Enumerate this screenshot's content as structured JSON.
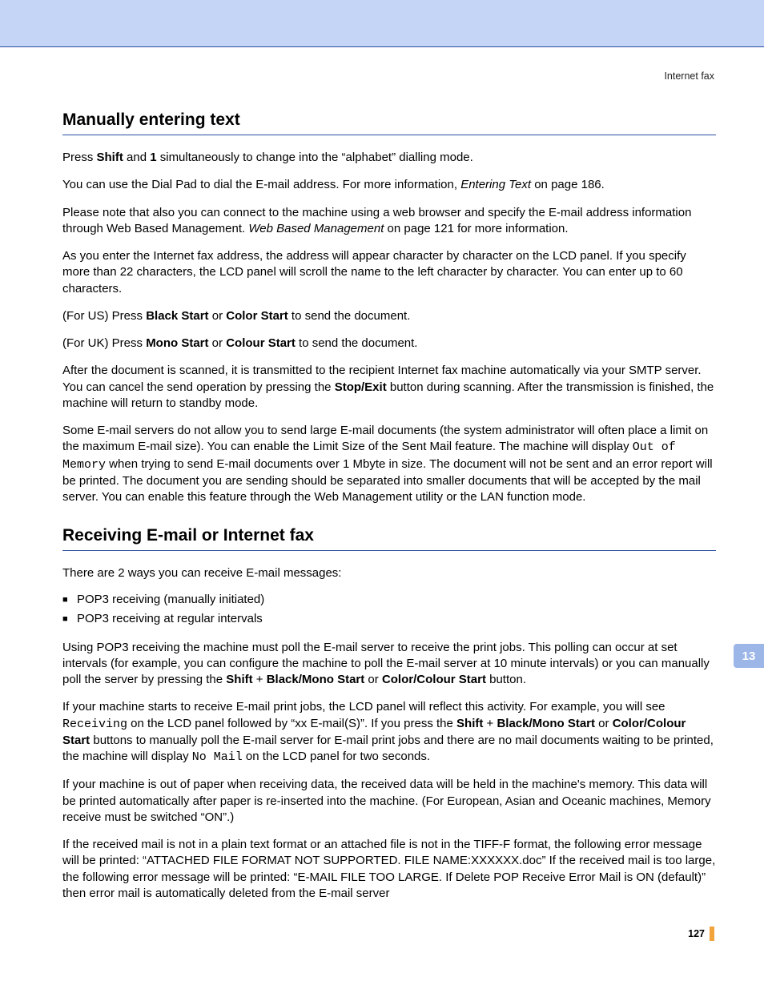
{
  "header": {
    "right": "Internet fax"
  },
  "section1": {
    "title": "Manually entering text",
    "p1_a": "Press ",
    "p1_b": "Shift",
    "p1_c": " and ",
    "p1_d": "1",
    "p1_e": " simultaneously to change into the “alphabet” dialling mode.",
    "p2_a": "You can use the Dial Pad to dial the E-mail address. For more information, ",
    "p2_b": "Entering Text",
    "p2_c": " on page 186.",
    "p3_a": "Please note that also you can connect to the machine using a web browser and specify the E-mail address information through Web Based Management. ",
    "p3_b": "Web Based Management",
    "p3_c": " on page 121 for more information.",
    "p4": "As you enter the Internet fax address, the address will appear character by character on the LCD panel. If you specify more than 22 characters, the LCD panel will scroll the name to the left character by character. You can enter up to 60 characters.",
    "p5_a": "(For US) Press ",
    "p5_b": "Black Start",
    "p5_c": " or ",
    "p5_d": "Color Start",
    "p5_e": " to send the document.",
    "p6_a": "(For UK) Press ",
    "p6_b": "Mono Start",
    "p6_c": " or ",
    "p6_d": "Colour Start",
    "p6_e": " to send the document.",
    "p7_a": "After the document is scanned, it is transmitted to the recipient Internet fax machine automatically via your SMTP server. You can cancel the send operation by pressing the ",
    "p7_b": "Stop/Exit",
    "p7_c": " button during scanning. After the transmission is finished, the machine will return to standby mode.",
    "p8_a": "Some E-mail servers do not allow you to send large E-mail documents (the system administrator will often place a limit on the maximum E-mail size). You can enable the Limit Size of the Sent Mail feature. The machine will display ",
    "p8_b": "Out of Memory",
    "p8_c": " when trying to send E-mail documents over 1 Mbyte in size. The document will not be sent and an error report will be printed. The document you are sending should be separated into smaller documents that will be accepted by the mail server. You can enable this feature through the Web Management utility or the LAN function mode."
  },
  "section2": {
    "title": "Receiving E-mail or Internet fax",
    "p1": "There are 2 ways you can receive E-mail messages:",
    "li1": "POP3 receiving (manually initiated)",
    "li2": "POP3 receiving at regular intervals",
    "p2_a": "Using POP3 receiving the machine must poll the E-mail server to receive the print jobs. This polling can occur at set intervals (for example, you can configure the machine to poll the E-mail server at 10 minute intervals) or you can manually poll the server by pressing the ",
    "p2_b": "Shift",
    "p2_c": " + ",
    "p2_d": "Black",
    "p2_e": "/",
    "p2_f": "Mono Start",
    "p2_g": " or ",
    "p2_h": "Color",
    "p2_i": "/",
    "p2_j": "Colour Start",
    "p2_k": " button.",
    "p3_a": "If your machine starts to receive E-mail print jobs, the LCD panel will reflect this activity. For example, you will see ",
    "p3_b": "Receiving",
    "p3_c": " on the LCD panel followed by “xx E-mail(S)”. If you press the ",
    "p3_d": "Shift",
    "p3_e": " + ",
    "p3_f": "Black",
    "p3_g": "/",
    "p3_h": "Mono Start",
    "p3_i": " or ",
    "p3_j": "Color",
    "p3_k": "/",
    "p3_l": "Colour Start",
    "p3_m": " buttons to manually poll the E-mail server for E-mail print jobs and there are no mail documents waiting to be printed, the machine will display ",
    "p3_n": "No Mail",
    "p3_o": " on the LCD panel for two seconds.",
    "p4": "If your machine is out of paper when receiving data, the received data will be held in the machine's memory. This data will be printed automatically after paper is re-inserted into the machine. (For European, Asian and Oceanic machines, Memory receive must be switched “ON”.)",
    "p5": "If the received mail is not in a plain text format or an attached file is not in the TIFF-F format, the following error message will be printed: “ATTACHED FILE FORMAT NOT SUPPORTED. FILE NAME:XXXXXX.doc” If the received mail is too large, the following error message will be printed: “E-MAIL FILE TOO LARGE. If Delete POP Receive Error Mail is ON (default)” then error mail is automatically deleted from the E-mail server"
  },
  "sidetab": "13",
  "pagenum": "127"
}
